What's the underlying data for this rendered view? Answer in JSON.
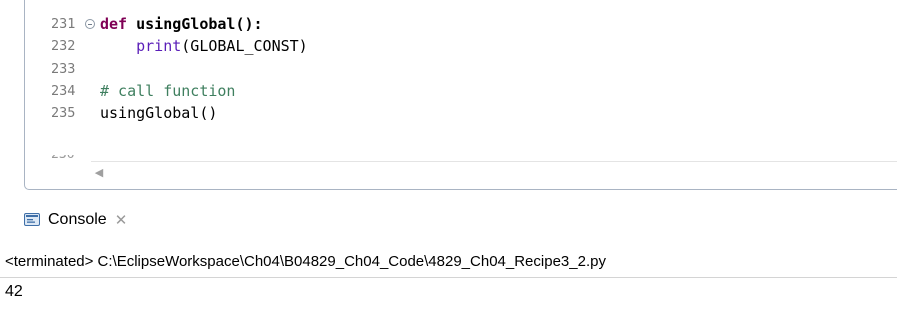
{
  "editor": {
    "lines": [
      {
        "number": "231",
        "folded": true,
        "parts": [
          {
            "t": "def ",
            "c": "kw"
          },
          {
            "t": "usingGlobal",
            "c": "fn"
          },
          {
            "t": "():",
            "c": "fn"
          }
        ]
      },
      {
        "number": "232",
        "folded": false,
        "parts": [
          {
            "t": "    "
          },
          {
            "t": "print",
            "c": "bi"
          },
          {
            "t": "(GLOBAL_CONST)"
          }
        ]
      },
      {
        "number": "233",
        "folded": false,
        "parts": []
      },
      {
        "number": "234",
        "folded": false,
        "parts": [
          {
            "t": "# call function",
            "c": "cm"
          }
        ]
      },
      {
        "number": "235",
        "folded": false,
        "parts": [
          {
            "t": "usingGlobal()"
          }
        ]
      }
    ],
    "scroll_left_arrow": "◀"
  },
  "console": {
    "tab_label": "Console",
    "close_symbol": "✕",
    "status": "<terminated> C:\\EclipseWorkspace\\Ch04\\B04829_Ch04_Code\\4829_Ch04_Recipe3_2.py",
    "output": "42"
  },
  "colors": {
    "keyword": "#7f0055",
    "builtin": "#5a1eb8",
    "comment": "#3f7f5f",
    "line_number": "#7a7a7a",
    "panel_border": "#a9b4c3"
  },
  "icons": {
    "fold": "collapse-fold-icon",
    "console": "console-view-icon",
    "close": "close-icon",
    "scroll_left": "scroll-left-arrow-icon"
  }
}
